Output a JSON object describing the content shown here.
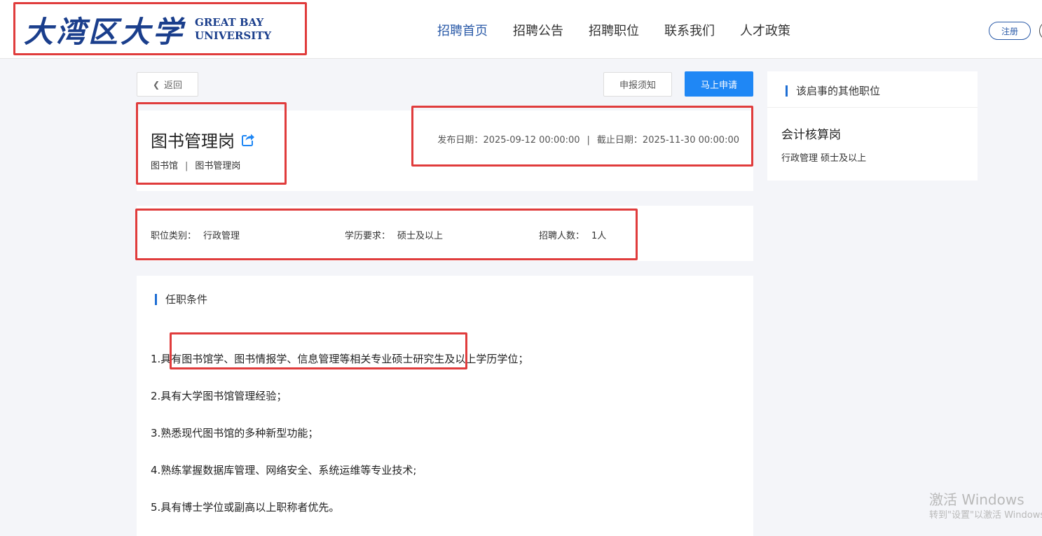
{
  "header": {
    "logo": {
      "cn": "大湾区大学",
      "en_line1": "GREAT BAY",
      "en_line2": "UNIVERSITY"
    },
    "nav": [
      "招聘首页",
      "招聘公告",
      "招聘职位",
      "联系我们",
      "人才政策"
    ],
    "active_nav": "招聘首页",
    "register_label": "注册"
  },
  "toolbar": {
    "back_label": "返回",
    "notice_label": "申报须知",
    "apply_label": "马上申请"
  },
  "job": {
    "title": "图书管理岗",
    "department": "图书馆",
    "position": "图书管理岗",
    "publish_label": "发布日期：",
    "publish_date": "2025-09-12 00:00:00",
    "deadline_label": "截止日期：",
    "deadline_date": "2025-11-30 00:00:00"
  },
  "info": {
    "category_label": "职位类别：",
    "category": "行政管理",
    "education_label": "学历要求：",
    "education": "硕士及以上",
    "count_label": "招聘人数：",
    "count": "1人"
  },
  "requirements": {
    "heading": "任职条件",
    "items": [
      "1.具有图书馆学、图书情报学、信息管理等相关专业硕士研究生及以上学历学位；",
      "2.具有大学图书馆管理经验；",
      "3.熟悉现代图书馆的多种新型功能；",
      "4.熟练掌握数据库管理、网络安全、系统运维等专业技术;",
      "5.具有博士学位或副高以上职称者优先。"
    ]
  },
  "sidebar": {
    "heading": "该启事的其他职位",
    "other_job": {
      "title": "会计核算岗",
      "sub": "行政管理 硕士及以上"
    }
  },
  "watermark": {
    "line1": "激活 Windows",
    "line2": "转到\"设置\"以激活 Windows。"
  },
  "colors": {
    "brand": "#1a3e8c",
    "primary": "#1f87f5",
    "highlight": "#e03c3c",
    "accent_bar": "#1f6fd4"
  },
  "icons": {
    "back": "chevron-left-icon",
    "share": "share-icon"
  }
}
